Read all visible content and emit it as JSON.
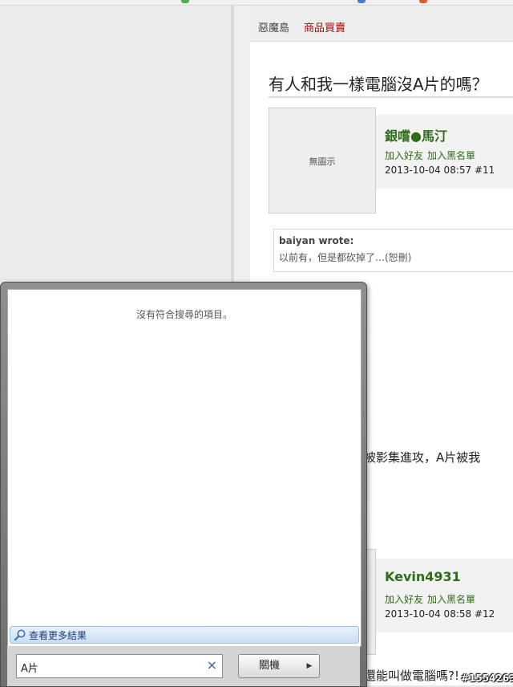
{
  "background_app": {
    "breadcrumb": [
      "惡魔島",
      "商品買賣"
    ],
    "thread_title": "有人和我一樣電腦沒A片的嗎？",
    "posts": [
      {
        "avatar_text": "無圖示",
        "author": "銀嚐●馬汀",
        "actions": [
          "加入好友",
          "加入黑名單"
        ],
        "datetime": "2013-10-04 08:57",
        "post_number": "#11",
        "quote_author": "baiyan wrote:",
        "quote_text": "以前有，但是都砍掉了…(恕刪)",
        "body_fragment": "被影集進攻，A片被我"
      },
      {
        "author": "Kevin4931",
        "actions": [
          "加入好友",
          "加入黑名單"
        ],
        "datetime": "2013-10-04 08:58",
        "post_number": "#12",
        "body_fragment": "還能叫做電腦嗎?!"
      }
    ]
  },
  "search_popup": {
    "no_results_text": "沒有符合搜尋的項目。",
    "see_more_label": "查看更多結果",
    "search_value": "A片",
    "shutdown_label": "關機",
    "clear_symbol": "×"
  },
  "watermark": "#1554263",
  "colors": {
    "link_green": "#2f6b19",
    "breadcrumb_red": "#b00000",
    "see_more_blue": "#1e3f74"
  }
}
